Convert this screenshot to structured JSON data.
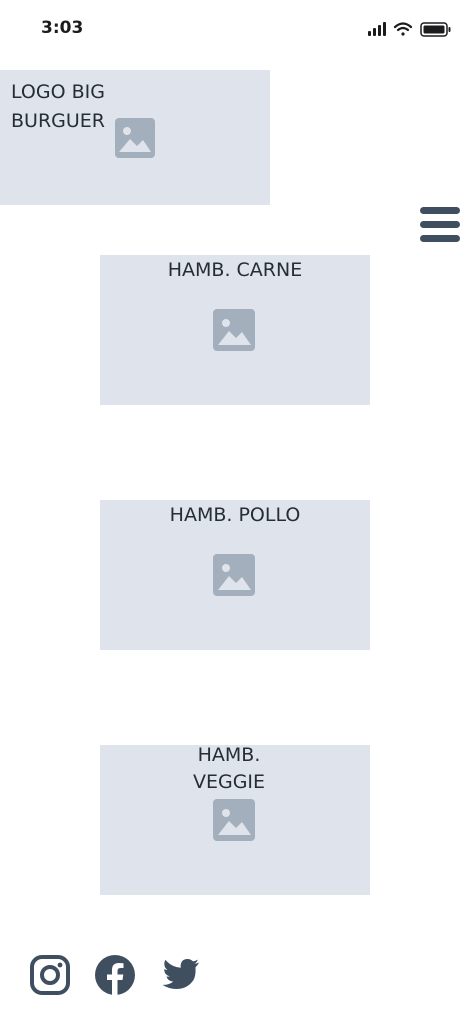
{
  "status_bar": {
    "time": "3:03",
    "icons": [
      "signal-icon",
      "wifi-icon",
      "battery-icon"
    ]
  },
  "header": {
    "logo_text": "LOGO BIG\nBURGUER",
    "menu_icon": "hamburger-menu-icon"
  },
  "products": [
    {
      "label": "HAMB. CARNE",
      "icon": "image-placeholder-icon"
    },
    {
      "label": "HAMB. POLLO",
      "icon": "image-placeholder-icon"
    },
    {
      "label": "HAMB.\nVEGGIE",
      "icon": "image-placeholder-icon"
    }
  ],
  "footer": {
    "social_icons": [
      "instagram-icon",
      "facebook-icon",
      "twitter-icon"
    ]
  },
  "colors": {
    "placeholder_bg": "#dfe4ec",
    "placeholder_icon": "#a3afbc",
    "text": "#252d36",
    "icon_dark": "#3f4f5f"
  }
}
